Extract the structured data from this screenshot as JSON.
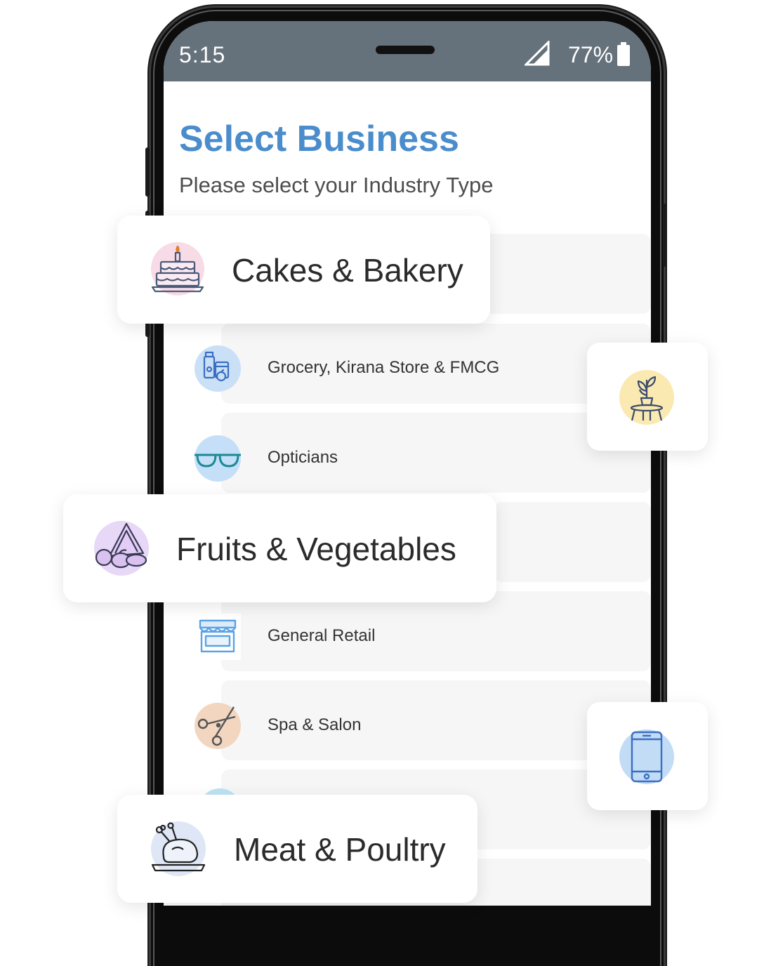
{
  "status_bar": {
    "time": "5:15",
    "battery_percent": "77%"
  },
  "header": {
    "title": "Select Business",
    "subtitle": "Please select your Industry Type"
  },
  "list_items": [
    {
      "label": "Grocery, Kirana Store & FMCG",
      "icon": "grocery-icon",
      "icon_bg": "#c9e0f7"
    },
    {
      "label": "Opticians",
      "icon": "glasses-icon",
      "icon_bg": "#c4dff7"
    },
    {
      "label": "General Retail",
      "icon": "store-icon",
      "icon_bg": "#ffffff"
    },
    {
      "label": "Spa & Salon",
      "icon": "scissors-icon",
      "icon_bg": "#f2d6c0"
    }
  ],
  "floating_cards": [
    {
      "label": "Cakes & Bakery",
      "icon": "cake-icon",
      "icon_bg": "#f7dbe6"
    },
    {
      "label": "Fruits & Vegetables",
      "icon": "fruits-icon",
      "icon_bg": "#e7d8f7"
    },
    {
      "label": "Meat & Poultry",
      "icon": "chicken-icon",
      "icon_bg": "#dfe6f5"
    }
  ],
  "mini_cards": [
    {
      "icon": "plant-icon",
      "icon_bg": "#fbe9b2"
    },
    {
      "icon": "mobile-phone-icon",
      "icon_bg": "#c2dcf6"
    }
  ],
  "colors": {
    "accent": "#4a8ccc",
    "status_bar": "#65717b",
    "row_background": "#f6f6f6"
  }
}
